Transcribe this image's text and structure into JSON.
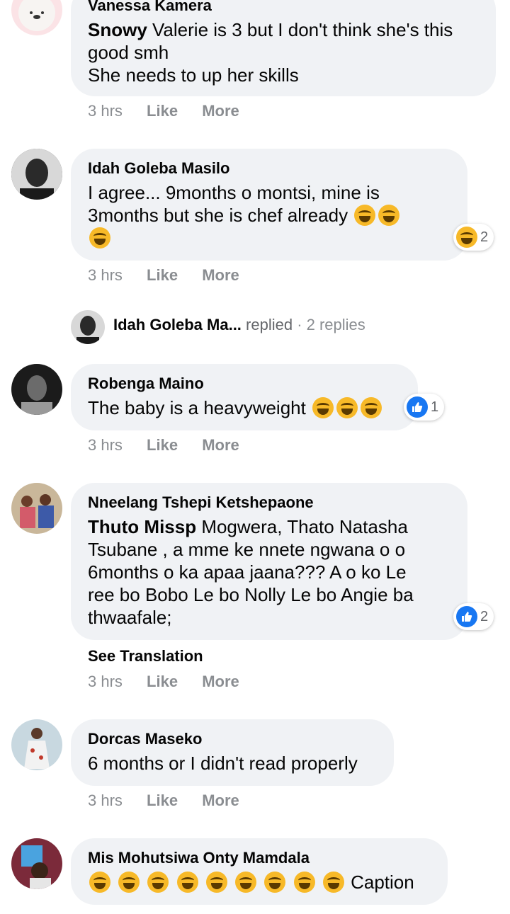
{
  "colors": {
    "bubble": "#f0f2f5",
    "like_blue": "#1877f2",
    "meta_gray": "#8a8d91",
    "emoji_yellow": "#f7b928"
  },
  "comments": [
    {
      "author": "Vanessa Kamera",
      "mention": "Snowy",
      "text_line1": " Valerie is 3 but I don't think she's this",
      "text_line2": "good smh",
      "text_line3": "She needs to up her skills",
      "time": "3 hrs",
      "like": "Like",
      "more": "More"
    },
    {
      "author": "Idah Goleba Masilo",
      "text_line1": "I agree... 9months o montsi, mine is",
      "text_line2": "3months but she is chef already ",
      "emoji": "rolling-on-floor-laughing-icon",
      "reaction_count": "2",
      "time": "3 hrs",
      "like": "Like",
      "more": "More"
    },
    {
      "reply_author": "Idah Goleba Ma...",
      "reply_verb": " replied",
      "reply_count": " · 2 replies"
    },
    {
      "author": "Robenga Maino",
      "text": "The baby is a heavyweight ",
      "emoji": "tears-of-joy-icon",
      "reaction_count": "1",
      "time": "3 hrs",
      "like": "Like",
      "more": "More"
    },
    {
      "author": "Nneelang Tshepi Ketshepaone",
      "mention": "Thuto Missp",
      "text_line1": " Mogwera, Thato Natasha",
      "text_line2": "Tsubane , a mme ke nnete ngwana o o",
      "text_line3": "6months o ka apaa jaana??? A o ko Le",
      "text_line4": "ree bo Bobo Le bo Nolly Le bo Angie ba",
      "text_line5": "thwaafale;",
      "reaction_count": "2",
      "see_translation": "See Translation",
      "time": "3 hrs",
      "like": "Like",
      "more": "More"
    },
    {
      "author": "Dorcas Maseko",
      "text": "6 months or I didn't read properly",
      "time": "3 hrs",
      "like": "Like",
      "more": "More"
    },
    {
      "author": "Mis Mohutsiwa Onty Mamdala",
      "caption": " Caption",
      "emoji": "rolling-on-floor-laughing-icon"
    }
  ]
}
